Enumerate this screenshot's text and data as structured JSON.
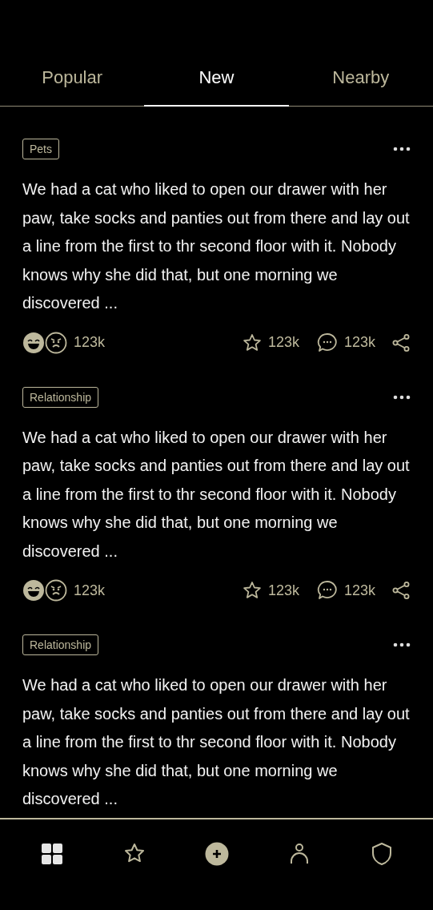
{
  "tabs": [
    {
      "label": "Popular",
      "selected": false
    },
    {
      "label": "New",
      "selected": true
    },
    {
      "label": "Nearby",
      "selected": false
    }
  ],
  "posts": [
    {
      "tag": "Pets",
      "text": "We had a cat who liked to open our drawer with her paw, take socks and panties out from there and lay out a line from the first to thr second floor with it. Nobody knows why she did that, but one morning we discovered ...",
      "reactions": "123k",
      "favorites": "123k",
      "comments": "123k"
    },
    {
      "tag": "Relationship",
      "text": "We had a cat who liked to open our drawer with her paw, take socks and panties out from there and lay out a line from the first to thr second floor with it. Nobody knows why she did that, but one morning we discovered ...",
      "reactions": "123k",
      "favorites": "123k",
      "comments": "123k"
    },
    {
      "tag": "Relationship",
      "text": "We had a cat who liked to open our drawer with her paw, take socks and panties out from there and lay out a line from the first to thr second floor with it. Nobody knows why she did that, but one morning we discovered ..."
    }
  ],
  "nav": [
    {
      "kind": "grid",
      "selected": true
    },
    {
      "kind": "star",
      "selected": false
    },
    {
      "kind": "add",
      "selected": false
    },
    {
      "kind": "person",
      "selected": false
    },
    {
      "kind": "shield",
      "selected": false
    }
  ]
}
